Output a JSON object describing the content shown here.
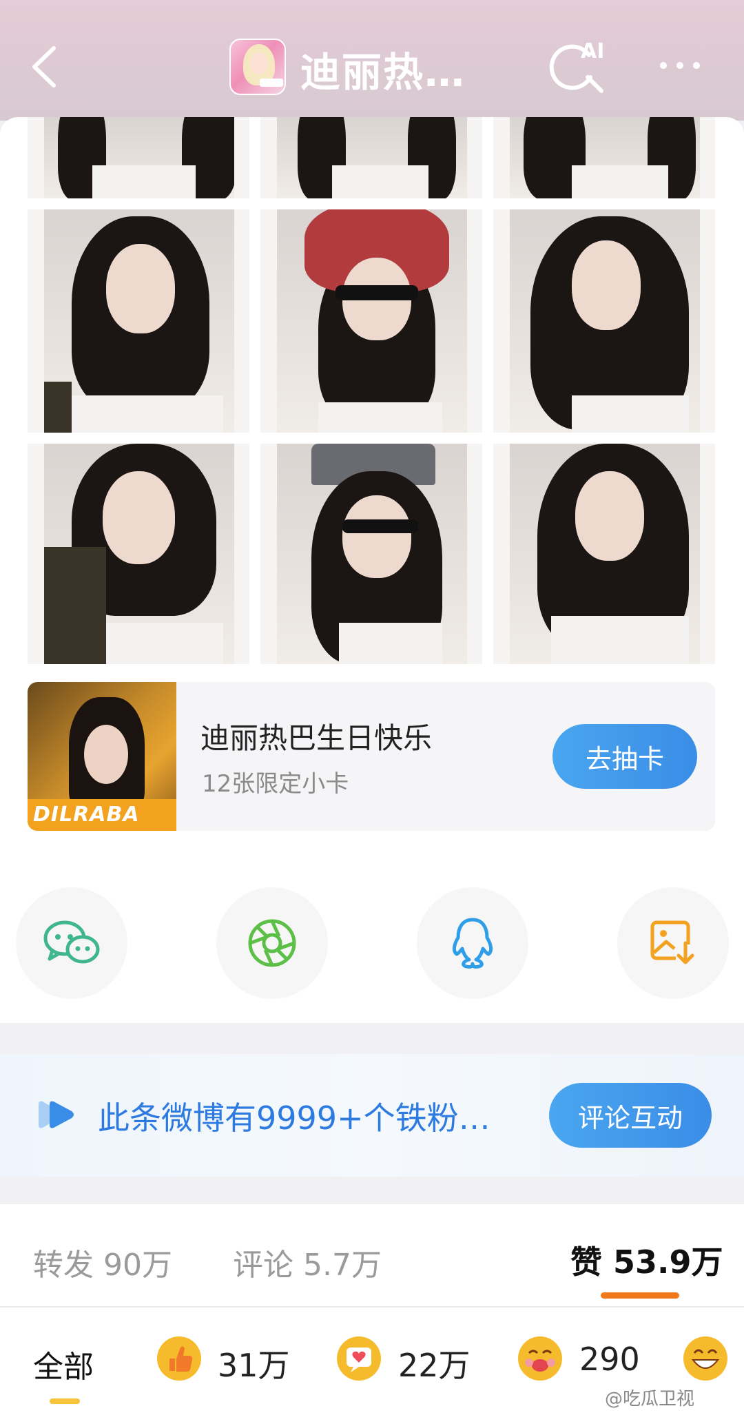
{
  "header": {
    "title": "迪丽热…",
    "ai_label": "AI"
  },
  "promo": {
    "title": "迪丽热巴生日快乐",
    "subtitle": "12张限定小卡",
    "button": "去抽卡",
    "image_text": "DILRABA"
  },
  "share": {
    "items": [
      "wechat-icon",
      "moments-icon",
      "qq-icon",
      "save-image-icon"
    ]
  },
  "fan_banner": {
    "text": "此条微博有9999+个铁粉…",
    "button": "评论互动"
  },
  "stats": {
    "repost_label": "转发",
    "repost_count": "90万",
    "comment_label": "评论",
    "comment_count": "5.7万",
    "like_label": "赞",
    "like_count": "53.9万"
  },
  "reactions": {
    "all_label": "全部",
    "items": [
      {
        "icon": "thumbs-up-icon",
        "count": "31万"
      },
      {
        "icon": "heart-message-icon",
        "count": "22万"
      },
      {
        "icon": "kiss-face-icon",
        "count": "290"
      }
    ],
    "watermark": "@吃瓜卫视"
  },
  "colors": {
    "accent_blue": "#3a8de6",
    "like_underline": "#f07a1b",
    "fan_text": "#2d7be0"
  }
}
